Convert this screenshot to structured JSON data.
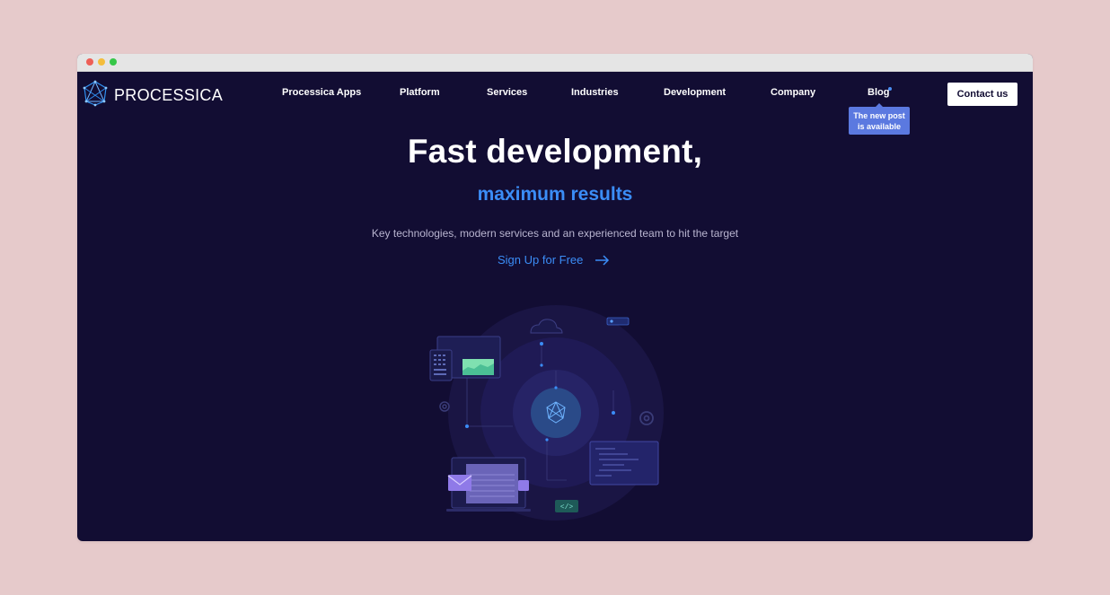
{
  "brand": {
    "name": "PROCESSICA",
    "logo_icon": "crystal-network-icon"
  },
  "nav": {
    "items": [
      {
        "label": "Processica Apps"
      },
      {
        "label": "Platform"
      },
      {
        "label": "Services"
      },
      {
        "label": "Industries"
      },
      {
        "label": "Development"
      },
      {
        "label": "Company"
      },
      {
        "label": "Blog"
      }
    ],
    "blog_tooltip": {
      "line1": "The new post",
      "line2": "is available"
    },
    "contact_label": "Contact us"
  },
  "hero": {
    "title": "Fast development,",
    "subtitle": "maximum results",
    "description": "Key technologies, modern services and an experienced team to hit the target",
    "cta_label": "Sign Up for Free",
    "cta_icon": "arrow-right-icon"
  },
  "code_tag": "</>",
  "colors": {
    "background": "#120d33",
    "accent": "#3b8df7",
    "tooltip": "#5b79e0",
    "page_bg": "#e6cacb"
  }
}
